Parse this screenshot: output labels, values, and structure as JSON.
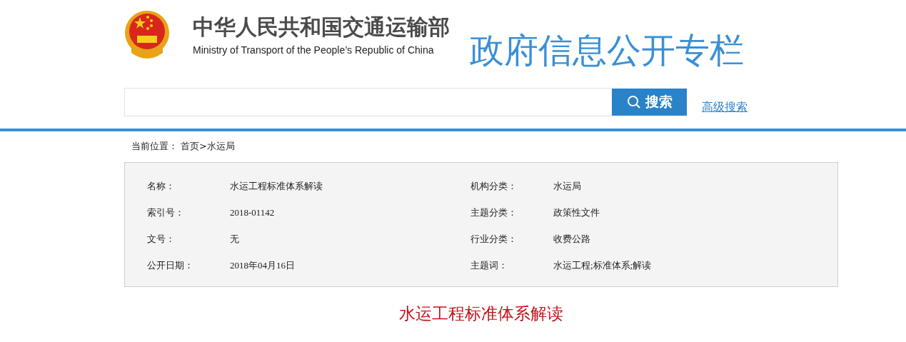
{
  "header": {
    "title_cn": "中华人民共和国交通运输部",
    "title_en": "Ministry of Transport of the People’s Republic of China",
    "column_title": "政府信息公开专栏"
  },
  "search": {
    "button": "搜索",
    "advanced_link": "高级搜索"
  },
  "breadcrumb": {
    "label": "当前位置：",
    "home": "首页",
    "current": ">水运局"
  },
  "info": {
    "left": [
      {
        "label": "名称：",
        "value": "水运工程标准体系解读"
      },
      {
        "label": "索引号：",
        "value": "2018-01142"
      },
      {
        "label": "文号：",
        "value": "无"
      },
      {
        "label": "公开日期：",
        "value": "2018年04月16日"
      }
    ],
    "right": [
      {
        "label": "机构分类：",
        "value": "水运局"
      },
      {
        "label": "主题分类：",
        "value": "政策性文件"
      },
      {
        "label": "行业分类：",
        "value": "收费公路"
      },
      {
        "label": "主题词：",
        "value": "水运工程;标准体系;解读"
      }
    ]
  },
  "article_title": "水运工程标准体系解读"
}
